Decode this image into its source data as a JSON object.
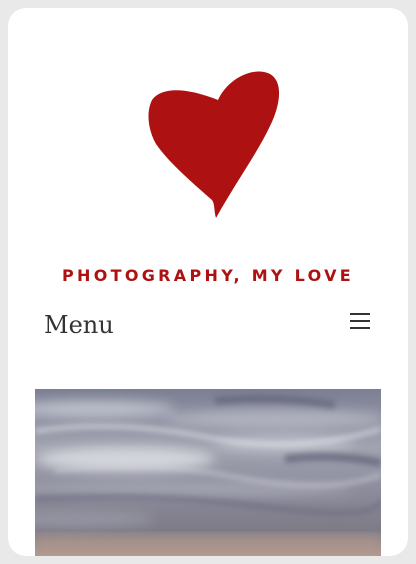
{
  "site": {
    "title": "PHOTOGRAPHY, MY LOVE",
    "logo_icon": "heart-icon",
    "brand_color": "#ad1111"
  },
  "nav": {
    "menu_label": "Menu",
    "toggle_icon": "hamburger-icon"
  },
  "hero": {
    "image_icon": "cloudy-sky-photo"
  }
}
